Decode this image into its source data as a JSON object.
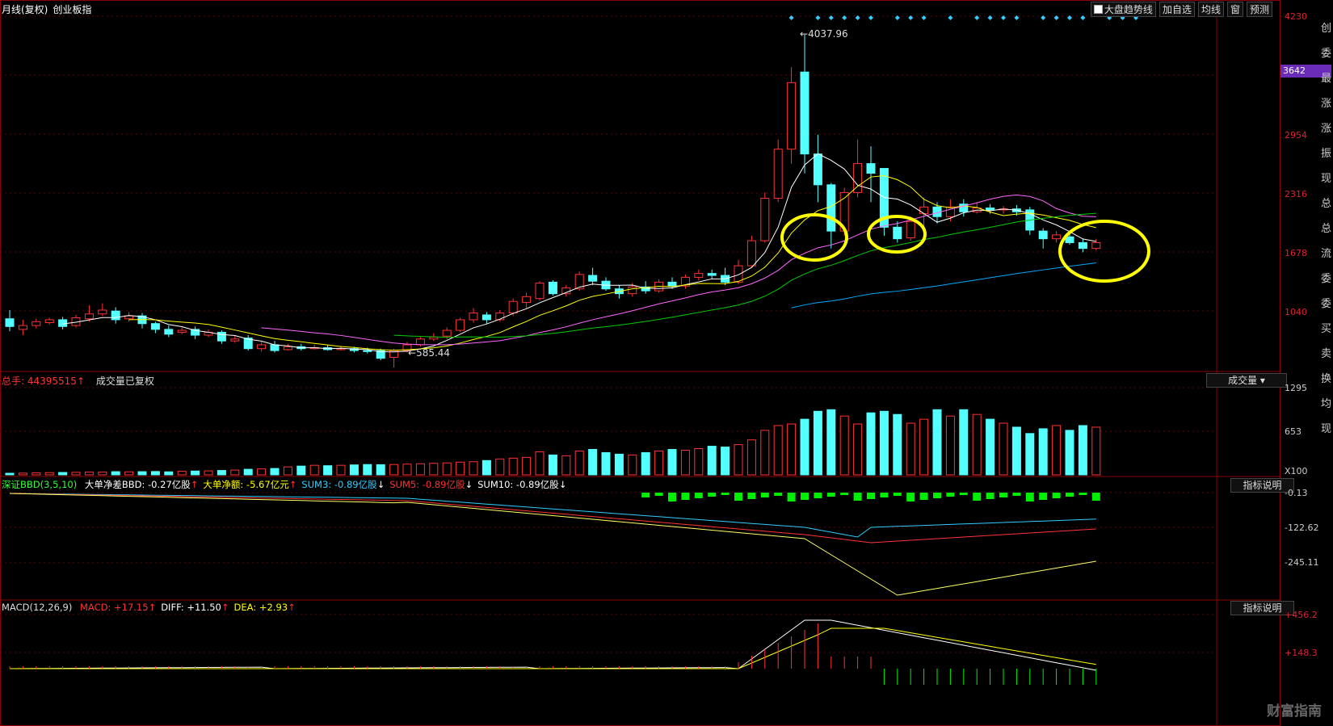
{
  "title": {
    "period": "月线(复权)",
    "name": "创业板指"
  },
  "toolbar": {
    "items": [
      "大盘趋势线",
      "加自选",
      "均线",
      "窗",
      "预测"
    ]
  },
  "price_axis": [
    "4230",
    "3642",
    "2954",
    "2316",
    "1678",
    "1040"
  ],
  "highlight_price": "3642",
  "annotations": {
    "high": "4037.96",
    "low": "585.44"
  },
  "volume": {
    "header": "总手: 44395515",
    "note": "成交量已复权",
    "dropdown": "成交量",
    "axis": [
      "1295",
      "653"
    ],
    "unit": "X100"
  },
  "bbd": {
    "name": "深证BBD(3,5,10)",
    "items": [
      {
        "text": "大单净差BBD: -0.27亿股",
        "color": "#ffffff",
        "arrow": "↑",
        "arrow_color": "#ff3333"
      },
      {
        "text": "大单净额: -5.67亿元",
        "color": "#ffff00",
        "arrow": "↑",
        "arrow_color": "#ff3333"
      },
      {
        "text": "SUM3: -0.89亿股",
        "color": "#33ccff",
        "arrow": "↓",
        "arrow_color": "#ffffff"
      },
      {
        "text": "SUM5: -0.89亿股",
        "color": "#ff3333",
        "arrow": "↓",
        "arrow_color": "#ffffff"
      },
      {
        "text": "SUM10: -0.89亿股",
        "color": "#ffffff",
        "arrow": "↓",
        "arrow_color": "#ffffff"
      }
    ],
    "axis": [
      "-0.13",
      "-122.62",
      "-245.11"
    ],
    "button": "指标说明"
  },
  "macd": {
    "name": "MACD(12,26,9)",
    "items": [
      {
        "text": "MACD: +17.15",
        "color": "#ff3333",
        "arrow": "↑",
        "arrow_color": "#ff3333"
      },
      {
        "text": "DIFF: +11.50",
        "color": "#ffffff",
        "arrow": "↑",
        "arrow_color": "#ff3333"
      },
      {
        "text": "DEA: +2.93",
        "color": "#ffff00",
        "arrow": "↑",
        "arrow_color": "#ff3333"
      }
    ],
    "axis": [
      "+456.2",
      "+148.3"
    ],
    "button": "指标说明"
  },
  "right_strip": [
    "创",
    "委",
    "最",
    "涨",
    "涨",
    "振",
    "现",
    "总",
    "总",
    "流",
    "委",
    "委",
    "买",
    "卖",
    "换",
    "均",
    "现"
  ],
  "watermark": "财富指南",
  "colors": {
    "up": "#ff3232",
    "down": "#54ffff",
    "ma5": "#ffffff",
    "ma10": "#ffff00",
    "ma20": "#ff66ff",
    "ma30": "#00cc00",
    "ma60": "#00aaff"
  },
  "chart_data": {
    "type": "candlestick",
    "ylim": [
      585,
      4230
    ],
    "candles": [
      [
        1090,
        1010,
        1180,
        960
      ],
      [
        980,
        1020,
        1080,
        920
      ],
      [
        1020,
        1060,
        1090,
        990
      ],
      [
        1050,
        1080,
        1100,
        1030
      ],
      [
        1080,
        1010,
        1110,
        980
      ],
      [
        1020,
        1100,
        1130,
        1000
      ],
      [
        1090,
        1140,
        1230,
        1060
      ],
      [
        1140,
        1180,
        1250,
        1120
      ],
      [
        1170,
        1080,
        1210,
        1040
      ],
      [
        1090,
        1120,
        1160,
        1060
      ],
      [
        1120,
        1040,
        1150,
        990
      ],
      [
        1040,
        980,
        1060,
        940
      ],
      [
        980,
        930,
        1020,
        900
      ],
      [
        950,
        970,
        1000,
        930
      ],
      [
        980,
        920,
        1010,
        880
      ],
      [
        920,
        950,
        980,
        900
      ],
      [
        950,
        860,
        970,
        830
      ],
      [
        860,
        880,
        920,
        840
      ],
      [
        890,
        780,
        920,
        760
      ],
      [
        780,
        820,
        850,
        750
      ],
      [
        820,
        760,
        860,
        740
      ],
      [
        770,
        800,
        830,
        760
      ],
      [
        800,
        780,
        830,
        760
      ],
      [
        780,
        790,
        820,
        770
      ],
      [
        790,
        770,
        820,
        760
      ],
      [
        770,
        780,
        810,
        760
      ],
      [
        780,
        760,
        800,
        740
      ],
      [
        760,
        750,
        790,
        730
      ],
      [
        760,
        680,
        780,
        660
      ],
      [
        690,
        760,
        780,
        585
      ],
      [
        760,
        820,
        850,
        740
      ],
      [
        820,
        880,
        900,
        800
      ],
      [
        880,
        900,
        940,
        860
      ],
      [
        910,
        970,
        1000,
        880
      ],
      [
        970,
        1080,
        1100,
        950
      ],
      [
        1080,
        1150,
        1200,
        1050
      ],
      [
        1130,
        1080,
        1160,
        1040
      ],
      [
        1080,
        1150,
        1180,
        1060
      ],
      [
        1150,
        1270,
        1300,
        1120
      ],
      [
        1260,
        1320,
        1360,
        1200
      ],
      [
        1300,
        1460,
        1480,
        1280
      ],
      [
        1470,
        1350,
        1490,
        1330
      ],
      [
        1350,
        1410,
        1440,
        1320
      ],
      [
        1400,
        1550,
        1580,
        1380
      ],
      [
        1540,
        1480,
        1620,
        1440
      ],
      [
        1480,
        1400,
        1520,
        1380
      ],
      [
        1400,
        1350,
        1440,
        1300
      ],
      [
        1350,
        1420,
        1460,
        1320
      ],
      [
        1420,
        1380,
        1480,
        1350
      ],
      [
        1380,
        1470,
        1500,
        1360
      ],
      [
        1470,
        1430,
        1520,
        1400
      ],
      [
        1430,
        1520,
        1550,
        1400
      ],
      [
        1520,
        1560,
        1600,
        1490
      ],
      [
        1560,
        1540,
        1600,
        1500
      ],
      [
        1540,
        1470,
        1620,
        1440
      ],
      [
        1470,
        1640,
        1700,
        1450
      ],
      [
        1640,
        1900,
        1950,
        1620
      ],
      [
        1900,
        2340,
        2400,
        1880
      ],
      [
        2340,
        2850,
        2950,
        2300
      ],
      [
        2850,
        3540,
        3700,
        2700
      ],
      [
        3650,
        2800,
        4037,
        2600
      ],
      [
        2800,
        2480,
        3000,
        2300
      ],
      [
        2480,
        2000,
        2500,
        1820
      ],
      [
        2000,
        2400,
        2450,
        1950
      ],
      [
        2400,
        2700,
        2950,
        2350
      ],
      [
        2700,
        2600,
        2880,
        2300
      ],
      [
        2650,
        2040,
        2650,
        1950
      ],
      [
        2040,
        1920,
        2100,
        1880
      ],
      [
        1930,
        2100,
        2150,
        1900
      ],
      [
        2180,
        2250,
        2350,
        2050
      ],
      [
        2250,
        2150,
        2300,
        2080
      ],
      [
        2150,
        2250,
        2330,
        2100
      ],
      [
        2280,
        2200,
        2330,
        2150
      ],
      [
        2200,
        2240,
        2300,
        2180
      ],
      [
        2240,
        2220,
        2280,
        2180
      ],
      [
        2220,
        2230,
        2260,
        2180
      ],
      [
        2230,
        2200,
        2270,
        2160
      ],
      [
        2220,
        2010,
        2250,
        1960
      ],
      [
        2000,
        1920,
        2030,
        1820
      ],
      [
        1920,
        1960,
        2000,
        1880
      ],
      [
        1940,
        1880,
        1990,
        1860
      ],
      [
        1880,
        1820,
        1920,
        1780
      ],
      [
        1820,
        1880,
        1920,
        1800
      ]
    ],
    "volume": [
      20,
      22,
      25,
      28,
      30,
      32,
      35,
      35,
      40,
      38,
      40,
      42,
      38,
      45,
      48,
      50,
      55,
      60,
      70,
      75,
      80,
      100,
      110,
      120,
      115,
      120,
      125,
      130,
      128,
      130,
      135,
      140,
      145,
      150,
      160,
      165,
      180,
      200,
      210,
      220,
      290,
      250,
      240,
      300,
      320,
      280,
      260,
      250,
      280,
      300,
      320,
      310,
      330,
      360,
      350,
      380,
      440,
      560,
      620,
      640,
      700,
      800,
      820,
      740,
      640,
      780,
      800,
      760,
      650,
      700,
      820,
      740,
      820,
      760,
      700,
      650,
      600,
      520,
      580,
      620,
      560,
      620,
      600
    ],
    "macd_hist": [
      10,
      10,
      10,
      10,
      10,
      10,
      10,
      10,
      10,
      10,
      10,
      10,
      10,
      10,
      10,
      10,
      10,
      10,
      10,
      10,
      10,
      10,
      10,
      10,
      10,
      10,
      10,
      10,
      10,
      10,
      10,
      10,
      10,
      10,
      10,
      10,
      10,
      10,
      10,
      10,
      10,
      10,
      10,
      10,
      10,
      10,
      10,
      10,
      10,
      10,
      10,
      10,
      10,
      10,
      10,
      10,
      10,
      10,
      10,
      10,
      10,
      10,
      10,
      10,
      10,
      10,
      10,
      10,
      10,
      10,
      10,
      10,
      10,
      10,
      10,
      10,
      10,
      10,
      10,
      10,
      10,
      10,
      10
    ]
  }
}
